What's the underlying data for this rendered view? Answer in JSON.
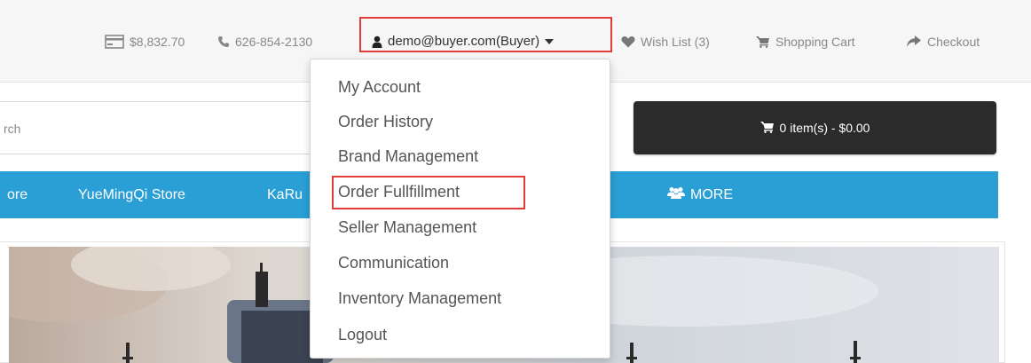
{
  "topbar": {
    "balance": "$8,832.70",
    "phone": "626-854-2130",
    "account": "demo@buyer.com(Buyer)",
    "wishlist": "Wish List (3)",
    "cart": "Shopping Cart",
    "checkout": "Checkout"
  },
  "search": {
    "value": "rch"
  },
  "cart_button": {
    "label": "0 item(s) - $0.00"
  },
  "nav": {
    "items": [
      "ore",
      "YueMingQi Store",
      "KaRu"
    ],
    "more": "MORE"
  },
  "dropdown": {
    "items": [
      "My Account",
      "Order History",
      "Brand Management",
      "Order Fullfillment",
      "Seller Management",
      "Communication",
      "Inventory Management",
      "Logout"
    ]
  },
  "colors": {
    "nav_bg": "#2a9fd6",
    "cart_bg": "#2b2b2b",
    "highlight": "#e03c3c"
  }
}
